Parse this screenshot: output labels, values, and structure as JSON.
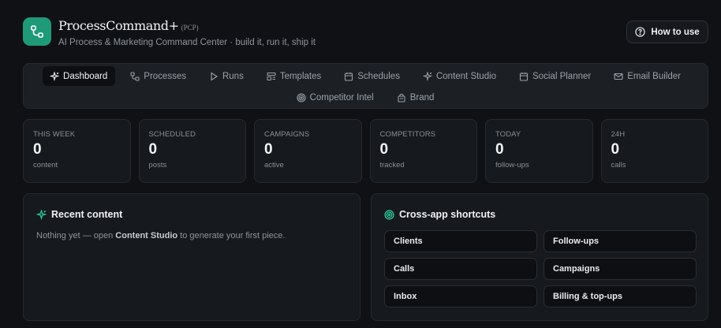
{
  "app": {
    "name": "ProcessCommand+",
    "tag": "(PCP)",
    "subtitle": "AI Process & Marketing Command Center · build it, run it, ship it",
    "logo_icon": "workflow-nodes-icon",
    "accent": "#1e9a79"
  },
  "header": {
    "howto_label": "How to use"
  },
  "nav": {
    "row1": [
      {
        "label": "Dashboard",
        "icon": "sparkles-icon",
        "active": true
      },
      {
        "label": "Processes",
        "icon": "workflow-icon"
      },
      {
        "label": "Runs",
        "icon": "play-icon"
      },
      {
        "label": "Templates",
        "icon": "template-icon"
      },
      {
        "label": "Schedules",
        "icon": "calendar-icon"
      },
      {
        "label": "Content Studio",
        "icon": "sparkles-icon"
      },
      {
        "label": "Social Planner",
        "icon": "calendar-icon"
      },
      {
        "label": "Email Builder",
        "icon": "mail-icon"
      }
    ],
    "row2": [
      {
        "label": "Competitor Intel",
        "icon": "target-icon"
      },
      {
        "label": "Brand",
        "icon": "brand-icon"
      }
    ]
  },
  "stats": [
    {
      "label": "THIS WEEK",
      "value": "0",
      "unit": "content"
    },
    {
      "label": "SCHEDULED",
      "value": "0",
      "unit": "posts"
    },
    {
      "label": "CAMPAIGNS",
      "value": "0",
      "unit": "active"
    },
    {
      "label": "COMPETITORS",
      "value": "0",
      "unit": "tracked"
    },
    {
      "label": "TODAY",
      "value": "0",
      "unit": "follow-ups"
    },
    {
      "label": "24H",
      "value": "0",
      "unit": "calls"
    }
  ],
  "recent": {
    "title": "Recent content",
    "empty_before": "Nothing yet — open ",
    "empty_link": "Content Studio",
    "empty_after": " to generate your first piece."
  },
  "shortcuts": {
    "title": "Cross-app shortcuts",
    "items": [
      "Clients",
      "Follow-ups",
      "Calls",
      "Campaigns",
      "Inbox",
      "Billing & top-ups"
    ]
  }
}
